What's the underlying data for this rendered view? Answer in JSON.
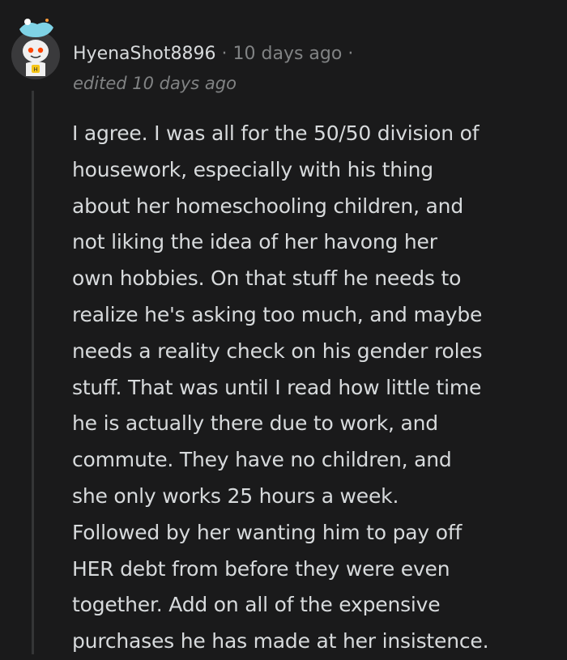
{
  "comment": {
    "author": "HyenaShot8896",
    "separator": "·",
    "timestamp": "10 days ago",
    "edited_label": "edited 10 days ago",
    "body_lines": [
      "I agree. I was all for the 50/50 division of",
      "housework, especially with his thing",
      "about her homeschooling children, and",
      "not liking the idea of her havong her",
      "own hobbies. On that stuff he needs to",
      "realize he's asking too much, and maybe",
      "needs a reality check on his gender roles",
      "stuff. That was until I read how little time",
      "he is actually there due to work, and",
      "commute. They have no children, and",
      "she only works 25 hours a week.",
      "Followed by her wanting him to pay off",
      "HER debt from before they were even",
      "together. Add on all of the expensive",
      "purchases he has made at her insistence."
    ]
  },
  "colors": {
    "background": "#1a1a1b",
    "text_primary": "#d7dadc",
    "text_meta": "#818384",
    "thread_line": "#343536"
  },
  "icons": {
    "avatar": "snoo-avatar-with-hat"
  }
}
